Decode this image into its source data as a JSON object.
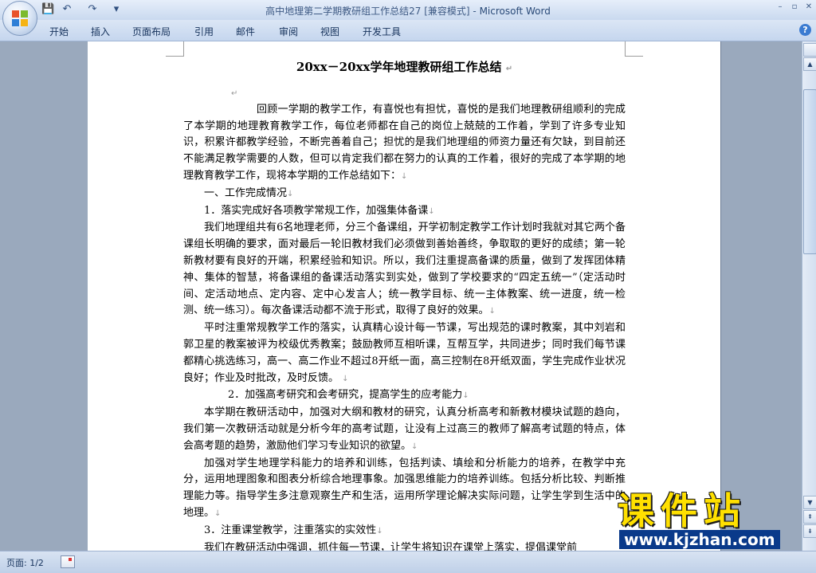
{
  "window": {
    "doc_title": "高中地理第二学期教研组工作总结27 [兼容模式]",
    "separator": " - ",
    "app_name": "Microsoft Word",
    "minimize": "–",
    "maximize": "▫",
    "close": "✕"
  },
  "quick_access": {
    "save": "💾",
    "undo": "↶",
    "redo": "↷",
    "customize": "▾"
  },
  "ribbon": {
    "tabs": [
      "开始",
      "插入",
      "页面布局",
      "引用",
      "邮件",
      "审阅",
      "视图",
      "开发工具"
    ],
    "help": "?"
  },
  "document": {
    "title": "20xx－20xx学年地理教研组工作总结",
    "paragraph_mark": "↵",
    "line_mark": "↓",
    "paragraphs": [
      "回顾一学期的教学工作，有喜悦也有担忧，喜悦的是我们地理教研组顺利的完成了本学期的地理教育教学工作，每位老师都在自己的岗位上兢兢的工作着，学到了许多专业知识，积累许都教学经验，不断完善着自己；担忧的是我们地理组的师资力量还有欠缺，到目前还不能满足教学需要的人数，但可以肯定我们都在努力的认真的工作着，很好的完成了本学期的地理教育教学工作，现将本学期的工作总结如下：",
      "一、工作完成情况",
      "1．落实完成好各项教学常规工作，加强集体备课",
      "我们地理组共有6名地理老师，分三个备课组，开学初制定教学工作计划时我就对其它两个备课组长明确的要求，面对最后一轮旧教材我们必须做到善始善终，争取取的更好的成绩；第一轮新教材要有良好的开端，积累经验和知识。所以，我们注重提高备课的质量，做到了发挥团体精神、集体的智慧，将备课组的备课活动落实到实处，做到了学校要求的“四定五统一”（定活动时间、定活动地点、定内容、定中心发言人；统一教学目标、统一主体教案、统一进度，统一检测、统一练习）。每次备课活动都不流于形式，取得了良好的效果。",
      "平时注重常规教学工作的落实，认真精心设计每一节课，写出规范的课时教案，其中刘岩和郭卫星的教案被评为校级优秀教案；鼓励教师互相听课，互帮互学，共同进步；同时我们每节课都精心挑选练习，高一、高二作业不超过8开纸一面，高三控制在8开纸双面，学生完成作业状况良好；作业及时批改，及时反馈。",
      "2．加强高考研究和会考研究，提高学生的应考能力",
      "本学期在教研活动中，加强对大纲和教材的研究，认真分析高考和新教材模块试题的趋向，我们第一次教研活动就是分析今年的高考试题，让没有上过高三的教师了解高考试题的特点，体会高考题的趋势，激励他们学习专业知识的欲望。",
      "加强对学生地理学科能力的培养和训练，包括判读、填绘和分析能力的培养，在教学中充分，运用地理图象和图表分析综合地理事象。加强思维能力的培养训练。包括分析比较、判断推理能力等。指导学生多注意观察生产和生活，运用所学理论解决实际问题，让学生学到生活中的地理。",
      "3．注重课堂教学，注重落实的实效性",
      "我们在教研活动中强调，抓住每一节课，让学生将知识在课堂上落实，提倡课堂前"
    ]
  },
  "statusbar": {
    "page_info": "页面: 1/2"
  },
  "scrollbar": {
    "up": "▲",
    "down": "▼",
    "prev_page": "⇞",
    "next_page": "⇟"
  },
  "watermark": {
    "brand": "课件站",
    "url": "www.kjzhan.com"
  }
}
